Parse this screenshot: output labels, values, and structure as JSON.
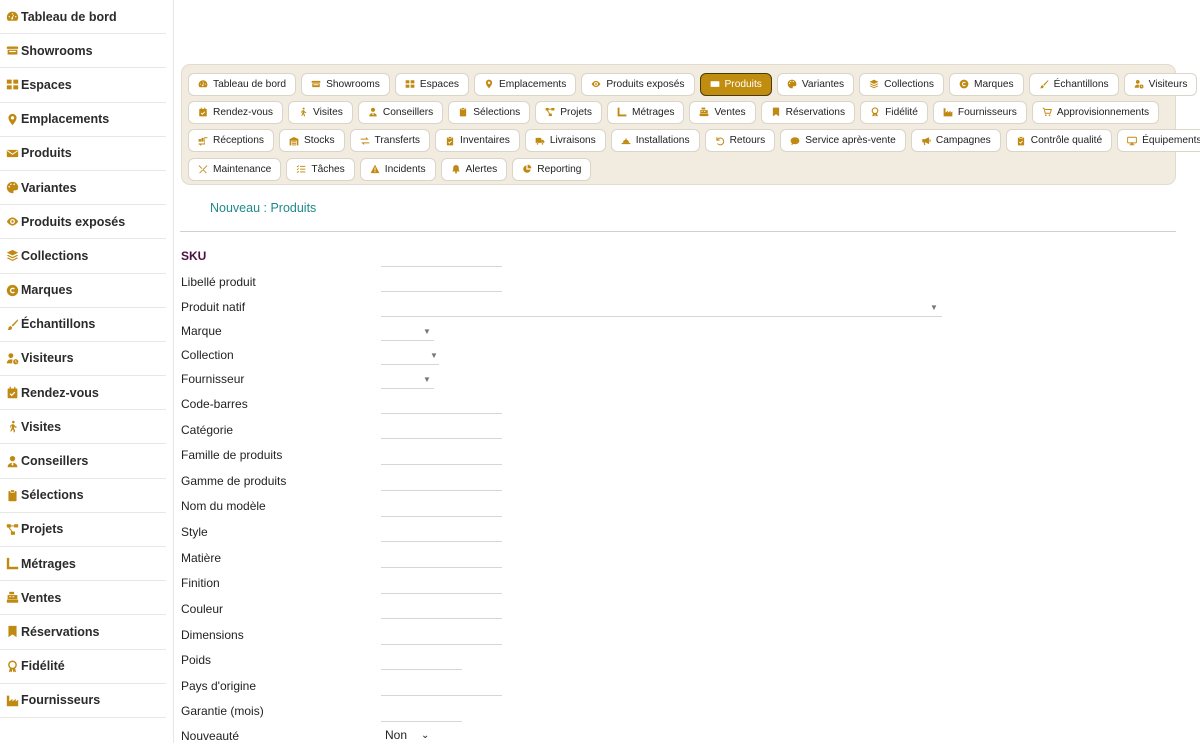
{
  "sidebar": {
    "items": [
      {
        "label": "Tableau de bord",
        "icon": "gauge-icon"
      },
      {
        "label": "Showrooms",
        "icon": "store-icon"
      },
      {
        "label": "Espaces",
        "icon": "grid-icon"
      },
      {
        "label": "Emplacements",
        "icon": "location-pin-icon"
      },
      {
        "label": "Produits",
        "icon": "envelope-icon"
      },
      {
        "label": "Variantes",
        "icon": "palette-icon"
      },
      {
        "label": "Produits exposés",
        "icon": "eye-icon"
      },
      {
        "label": "Collections",
        "icon": "layers-icon"
      },
      {
        "label": "Marques",
        "icon": "copyright-icon"
      },
      {
        "label": "Échantillons",
        "icon": "brush-icon"
      },
      {
        "label": "Visiteurs",
        "icon": "user-clock-icon"
      },
      {
        "label": "Rendez-vous",
        "icon": "calendar-check-icon"
      },
      {
        "label": "Visites",
        "icon": "walking-icon"
      },
      {
        "label": "Conseillers",
        "icon": "user-tie-icon"
      },
      {
        "label": "Sélections",
        "icon": "clipboard-icon"
      },
      {
        "label": "Projets",
        "icon": "project-diagram-icon"
      },
      {
        "label": "Métrages",
        "icon": "ruler-icon"
      },
      {
        "label": "Ventes",
        "icon": "cash-register-icon"
      },
      {
        "label": "Réservations",
        "icon": "bookmark-icon"
      },
      {
        "label": "Fidélité",
        "icon": "award-icon"
      },
      {
        "label": "Fournisseurs",
        "icon": "industry-icon"
      }
    ]
  },
  "tabs": {
    "rows": [
      [
        {
          "label": "Tableau de bord",
          "icon": "gauge-icon"
        },
        {
          "label": "Showrooms",
          "icon": "store-icon"
        },
        {
          "label": "Espaces",
          "icon": "grid-icon"
        },
        {
          "label": "Emplacements",
          "icon": "location-pin-icon"
        },
        {
          "label": "Produits exposés",
          "icon": "eye-icon"
        },
        {
          "label": "Produits",
          "icon": "envelope-icon",
          "active": true
        },
        {
          "label": "Variantes",
          "icon": "palette-icon"
        },
        {
          "label": "Collections",
          "icon": "layers-icon"
        },
        {
          "label": "Marques",
          "icon": "copyright-icon"
        },
        {
          "label": "Échantillons",
          "icon": "brush-icon"
        },
        {
          "label": "Visiteurs",
          "icon": "user-clock-icon"
        }
      ],
      [
        {
          "label": "Rendez-vous",
          "icon": "calendar-check-icon"
        },
        {
          "label": "Visites",
          "icon": "walking-icon"
        },
        {
          "label": "Conseillers",
          "icon": "user-tie-icon"
        },
        {
          "label": "Sélections",
          "icon": "clipboard-icon"
        },
        {
          "label": "Projets",
          "icon": "project-diagram-icon"
        },
        {
          "label": "Métrages",
          "icon": "ruler-icon"
        },
        {
          "label": "Ventes",
          "icon": "cash-register-icon"
        },
        {
          "label": "Réservations",
          "icon": "bookmark-icon"
        },
        {
          "label": "Fidélité",
          "icon": "award-icon"
        },
        {
          "label": "Fournisseurs",
          "icon": "industry-icon"
        },
        {
          "label": "Approvisionnements",
          "icon": "cart-icon"
        }
      ],
      [
        {
          "label": "Réceptions",
          "icon": "truck-loading-icon"
        },
        {
          "label": "Stocks",
          "icon": "warehouse-icon"
        },
        {
          "label": "Transferts",
          "icon": "exchange-icon"
        },
        {
          "label": "Inventaires",
          "icon": "clipboard-check-icon"
        },
        {
          "label": "Livraisons",
          "icon": "truck-icon"
        },
        {
          "label": "Installations",
          "icon": "hard-hat-icon"
        },
        {
          "label": "Retours",
          "icon": "undo-icon"
        },
        {
          "label": "Service après-vente",
          "icon": "comment-icon"
        },
        {
          "label": "Campagnes",
          "icon": "bullhorn-icon"
        },
        {
          "label": "Contrôle qualité",
          "icon": "clipboard-check-icon"
        },
        {
          "label": "Équipements",
          "icon": "desktop-icon"
        }
      ],
      [
        {
          "label": "Maintenance",
          "icon": "tools-icon"
        },
        {
          "label": "Tâches",
          "icon": "tasks-icon"
        },
        {
          "label": "Incidents",
          "icon": "warning-icon"
        },
        {
          "label": "Alertes",
          "icon": "bell-icon"
        },
        {
          "label": "Reporting",
          "icon": "pie-chart-icon"
        }
      ]
    ]
  },
  "form": {
    "title": "Nouveau : Produits",
    "fields": [
      {
        "label": "SKU",
        "required": true,
        "type": "text"
      },
      {
        "label": "Libellé produit",
        "type": "text"
      },
      {
        "label": "Produit natif",
        "type": "select-wide"
      },
      {
        "label": "Marque",
        "type": "select"
      },
      {
        "label": "Collection",
        "type": "select"
      },
      {
        "label": "Fournisseur",
        "type": "select"
      },
      {
        "label": "Code-barres",
        "type": "text"
      },
      {
        "label": "Catégorie",
        "type": "text"
      },
      {
        "label": "Famille de produits",
        "type": "text"
      },
      {
        "label": "Gamme de produits",
        "type": "text"
      },
      {
        "label": "Nom du modèle",
        "type": "text"
      },
      {
        "label": "Style",
        "type": "text"
      },
      {
        "label": "Matière",
        "type": "text"
      },
      {
        "label": "Finition",
        "type": "text"
      },
      {
        "label": "Couleur",
        "type": "text"
      },
      {
        "label": "Dimensions",
        "type": "text"
      },
      {
        "label": "Poids",
        "type": "number"
      },
      {
        "label": "Pays d'origine",
        "type": "text"
      },
      {
        "label": "Garantie (mois)",
        "type": "number"
      },
      {
        "label": "Nouveauté",
        "type": "bool"
      }
    ],
    "nouveaute_value": "Non"
  },
  "colors": {
    "accent": "#c18d0e",
    "icon": "#c08a12",
    "title_teal": "#1f8a8a",
    "panel_bg": "#f1ebe0",
    "required_label": "#4a1040"
  }
}
